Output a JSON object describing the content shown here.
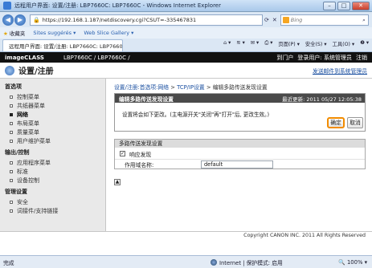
{
  "window": {
    "title": "远程用户界面: 设置/注册: LBP7660C: LBP7660C - Windows Internet Explorer",
    "minimize": "–",
    "maximize": "□",
    "close": "✕"
  },
  "browser": {
    "url": "https://192.168.1.187/netdiscovery.cgi?CSUT=-335467831",
    "search_engine": "Bing",
    "favorites_label": "收藏夹",
    "fav_links": [
      "Sites suggérés ▾",
      "Web Slice Gallery ▾"
    ],
    "tab_title": "远程用户界面: 设置/注册: LBP7660C: LBP7660C",
    "commands": [
      "页面(P) ▾",
      "安全(S) ▾",
      "工具(O) ▾",
      "❷ ▾"
    ]
  },
  "banner": {
    "product": "imageCLASS",
    "model": "LBP7660C / LBP7660C /",
    "links": [
      "到门户",
      "登录用户: 系统管理员",
      "注销"
    ]
  },
  "header": {
    "title": "设置/注册",
    "mail_admin": "发送邮件到系统管理员"
  },
  "sidebar": {
    "sections": [
      {
        "heading": "首选项",
        "items": [
          {
            "label": "控制菜单",
            "active": false
          },
          {
            "label": "共纸器菜单",
            "active": false
          },
          {
            "label": "网络",
            "active": true
          },
          {
            "label": "布局菜单",
            "active": false
          },
          {
            "label": "质量菜单",
            "active": false
          },
          {
            "label": "用户维护菜单",
            "active": false
          }
        ]
      },
      {
        "heading": "输出/控制",
        "items": [
          {
            "label": "应用程序菜单",
            "active": false
          },
          {
            "label": "标准",
            "active": false
          },
          {
            "label": "设备控制",
            "active": false
          }
        ]
      },
      {
        "heading": "管理设置",
        "items": [
          {
            "label": "安全",
            "active": false
          },
          {
            "label": "词接件/支持链接",
            "active": false
          }
        ]
      }
    ]
  },
  "breadcrumb": [
    "设置/注册:首选项:网络",
    "TCP/IP设置",
    "编辑多路传送发现设置"
  ],
  "edit_panel": {
    "title": "编辑多路传送发现设置",
    "last_updated": "最近更新: 2011 05/27 12:05:38",
    "message": "设置将会如下更改。(主电源开关\"关闭\"再\"打开\"后, 更改生效。)",
    "ok": "确定",
    "cancel": "取消"
  },
  "discovery_panel": {
    "title": "多路传送发现设置",
    "respond_label": "响应发现",
    "respond_checked": "✓",
    "scope_label": "作用域名称:",
    "scope_value": "default"
  },
  "page_top_icon": "▲",
  "footer": "Copyright CANON INC. 2011 All Rights Reserved",
  "statusbar": {
    "left": "完成",
    "zone": "Internet | 保护模式: 启用",
    "zoom": "🔍 100% ▾"
  }
}
